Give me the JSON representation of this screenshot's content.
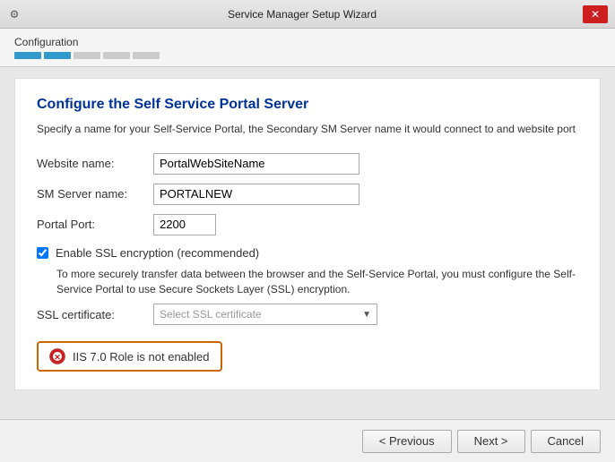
{
  "titleBar": {
    "icon": "⚙",
    "title": "Service Manager Setup Wizard",
    "closeIcon": "✕"
  },
  "progress": {
    "label": "Configuration",
    "segments": [
      {
        "active": true
      },
      {
        "active": true
      },
      {
        "active": false
      },
      {
        "active": false
      },
      {
        "active": false
      }
    ]
  },
  "pageTitle": "Configure the Self Service Portal Server",
  "description": "Specify a name for your Self-Service Portal, the Secondary SM Server name it would connect to and website port",
  "form": {
    "websiteNameLabel": "Website name:",
    "websiteNameValue": "PortalWebSiteName",
    "smServerLabel": "SM Server name:",
    "smServerValue": "PORTALNEW",
    "portalPortLabel": "Portal Port:",
    "portalPortValue": "2200",
    "sslCheckboxLabel": "Enable SSL encryption (recommended)",
    "sslNote": "To more securely transfer data between the browser and the Self-Service Portal, you must configure the Self-Service Portal to use Secure Sockets Layer (SSL) encryption.",
    "sslCertLabel": "SSL certificate:",
    "sslCertPlaceholder": "Select SSL certificate"
  },
  "warning": {
    "text": "IIS 7.0 Role is not enabled"
  },
  "footer": {
    "previousLabel": "< Previous",
    "nextLabel": "Next >",
    "cancelLabel": "Cancel"
  }
}
